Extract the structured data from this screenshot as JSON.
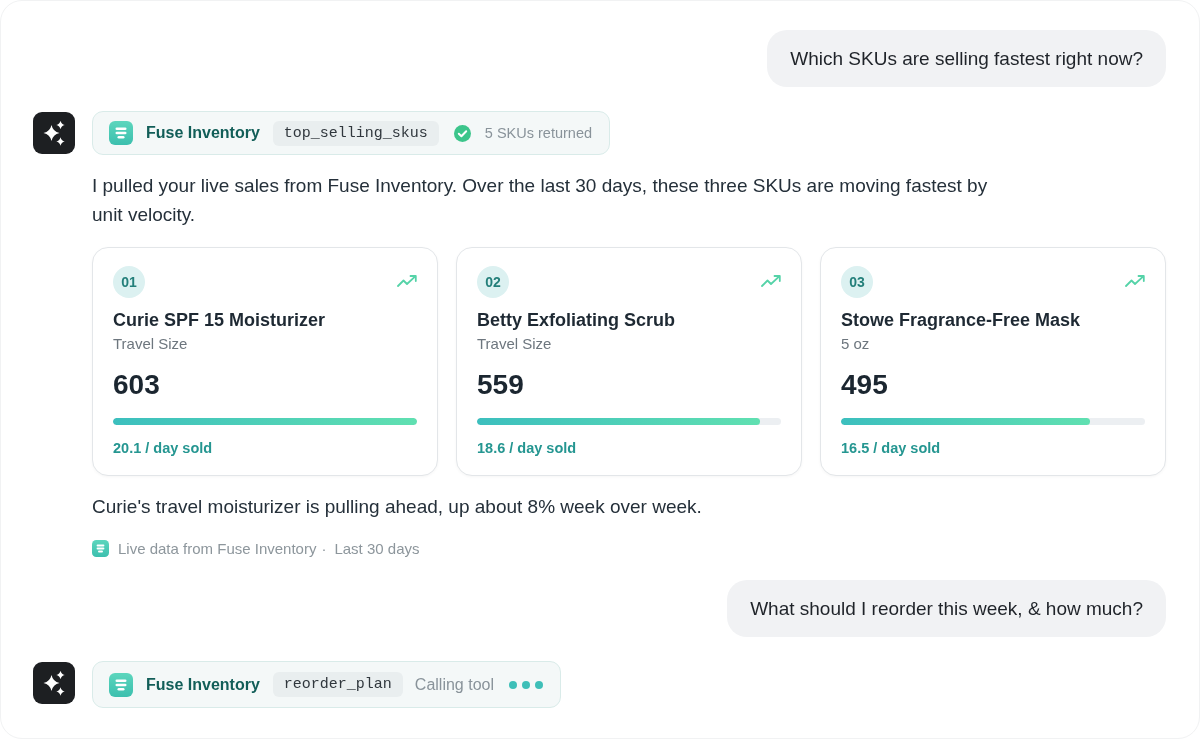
{
  "conversation": [
    {
      "kind": "user",
      "text": "Which SKUs are selling fastest right now?"
    },
    {
      "kind": "assistant",
      "tool_call": {
        "source": "Fuse Inventory",
        "tool": "top_selling_skus",
        "done": true,
        "status_text": "5 SKUs returned"
      },
      "intro": "I pulled your live sales from Fuse Inventory. Over the last 30 days, these three SKUs are moving fastest by unit velocity.",
      "products": [
        {
          "rank": "01",
          "name": "Curie SPF 15 Moisturizer",
          "variant": "Travel Size",
          "units": "603",
          "level": 1,
          "rate": "20.1 / day sold"
        },
        {
          "rank": "02",
          "name": "Betty Exfoliating Scrub",
          "variant": "Travel Size",
          "units": "559",
          "level": 0.93,
          "rate": "18.6 / day sold"
        },
        {
          "rank": "03",
          "name": "Stowe Fragrance-Free Mask",
          "variant": "5 oz",
          "units": "495",
          "level": 0.82,
          "rate": "16.5 / day sold"
        }
      ],
      "summary": "Curie's travel moisturizer is pulling ahead, up about 8% week over week.",
      "footnote": {
        "source": "Live data from Fuse Inventory",
        "separator": "·",
        "period": "Last 30 days"
      }
    },
    {
      "kind": "user",
      "text": "What should I reorder this week, & how much?"
    },
    {
      "kind": "assistant",
      "tool_call": {
        "source": "Fuse Inventory",
        "tool": "reorder_plan",
        "done": false,
        "status_text": "Calling tool"
      }
    }
  ]
}
